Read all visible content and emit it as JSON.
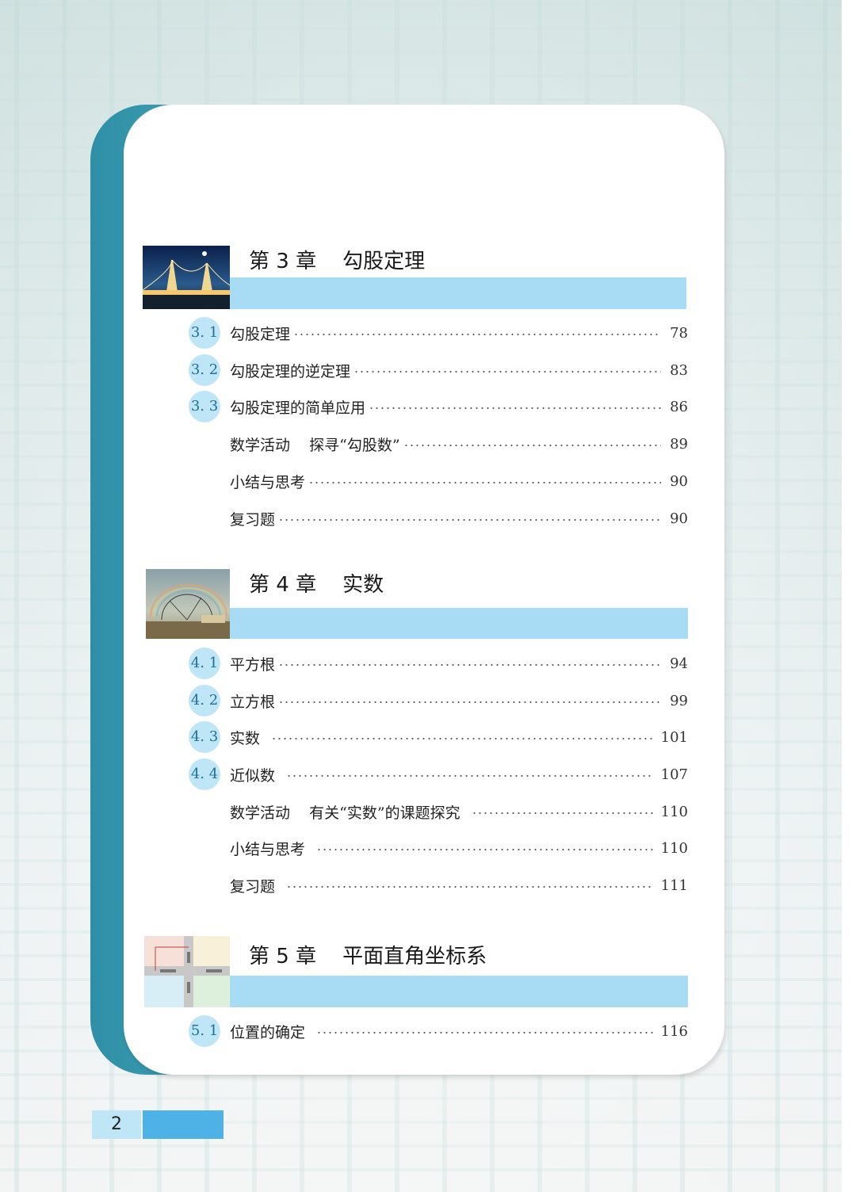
{
  "page_number": "2",
  "chapters": [
    {
      "title": "第 3 章    勾股定理",
      "entries": [
        {
          "num": "3. 1",
          "label": "勾股定理",
          "page": "78"
        },
        {
          "num": "3. 2",
          "label": "勾股定理的逆定理",
          "page": "83"
        },
        {
          "num": "3. 3",
          "label": "勾股定理的简单应用",
          "page": "86"
        },
        {
          "num": "",
          "label": "数学活动    探寻“勾股数”",
          "page": "89"
        },
        {
          "num": "",
          "label": "小结与思考",
          "page": "90"
        },
        {
          "num": "",
          "label": "复习题",
          "page": "90"
        }
      ]
    },
    {
      "title": "第 4 章    实数",
      "entries": [
        {
          "num": "4. 1",
          "label": "平方根",
          "page": "94"
        },
        {
          "num": "4. 2",
          "label": "立方根",
          "page": "99"
        },
        {
          "num": "4. 3",
          "label": "实数",
          "page": "101"
        },
        {
          "num": "4. 4",
          "label": "近似数",
          "page": "107"
        },
        {
          "num": "",
          "label": "数学活动    有关“实数”的课题探究",
          "page": "110"
        },
        {
          "num": "",
          "label": "小结与思考",
          "page": "110"
        },
        {
          "num": "",
          "label": "复习题",
          "page": "111"
        }
      ]
    },
    {
      "title": "第 5 章    平面直角坐标系",
      "entries": [
        {
          "num": "5. 1",
          "label": "位置的确定",
          "page": "116"
        }
      ]
    }
  ]
}
